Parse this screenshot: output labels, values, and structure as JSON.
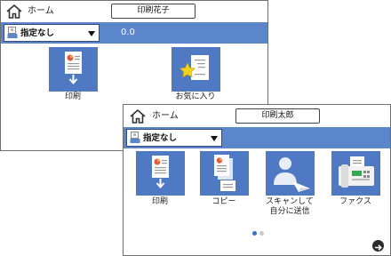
{
  "back_panel": {
    "header": {
      "home_label": "ホーム",
      "user_name": "印刷花子"
    },
    "bar": {
      "dropdown_label": "指定なし",
      "value_display": "0.0"
    },
    "tiles": [
      {
        "label": "印刷",
        "icon": "print-icon"
      },
      {
        "label": "お気に入り",
        "icon": "favorites-icon"
      }
    ]
  },
  "front_panel": {
    "header": {
      "home_label": "ホーム",
      "user_name": "印刷太郎"
    },
    "bar": {
      "dropdown_label": "指定なし"
    },
    "tiles": [
      {
        "label": "印刷",
        "icon": "print-icon"
      },
      {
        "label": "コピー",
        "icon": "copy-icon"
      },
      {
        "label_line1": "スキャンして",
        "label_line2": "自分に送信",
        "icon": "scan-to-me-icon"
      },
      {
        "label": "ファクス",
        "icon": "fax-icon"
      }
    ],
    "pagination": {
      "current_page": 1,
      "total_pages": 2
    },
    "next_icon": "arrow-right-circle-icon"
  },
  "colors": {
    "accent_blue": "#5b86cb",
    "tile_blue": "#4f79c3",
    "dot_active": "#3a6fc4",
    "dot_inactive": "#c8c8c8"
  }
}
